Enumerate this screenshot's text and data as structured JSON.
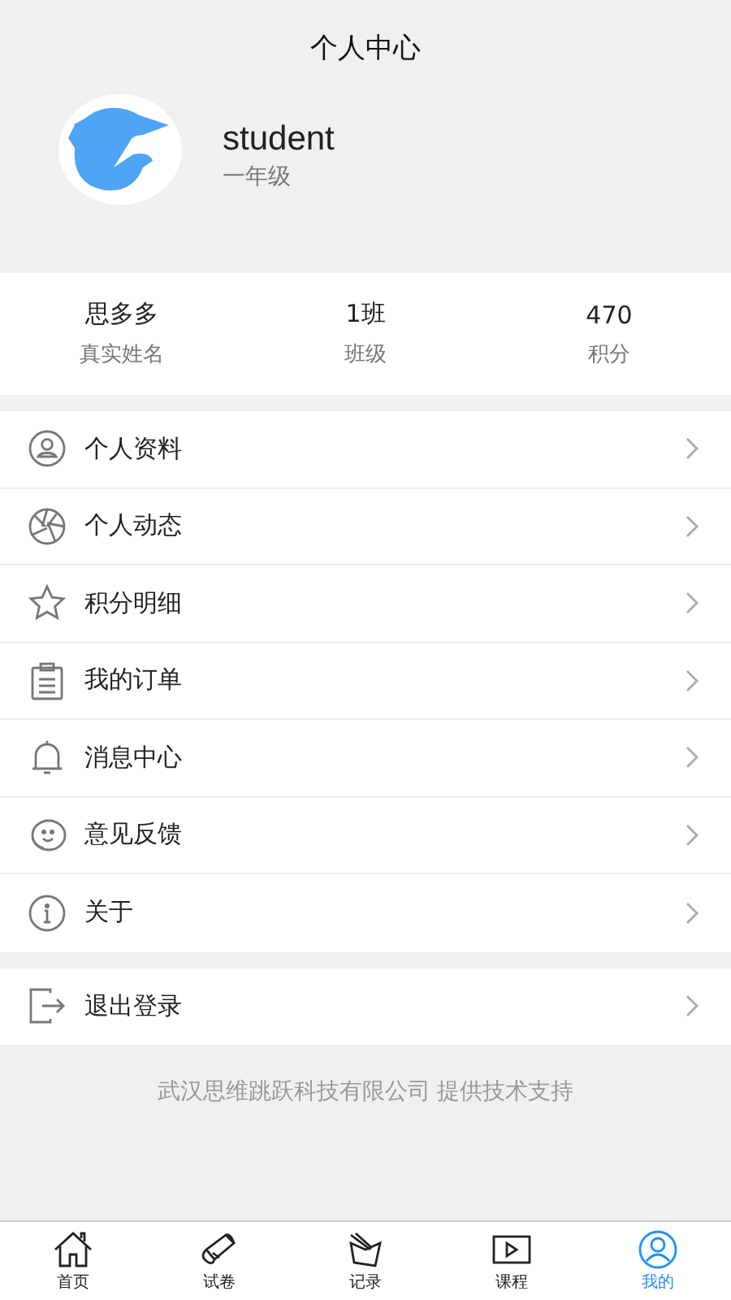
{
  "header": {
    "title": "个人中心"
  },
  "profile": {
    "username": "student",
    "grade": "一年级"
  },
  "stats": [
    {
      "value": "思多多",
      "label": "真实姓名"
    },
    {
      "value": "1班",
      "label": "班级"
    },
    {
      "value": "470",
      "label": "积分"
    }
  ],
  "menu": [
    {
      "kind": "profile",
      "label": "个人资料"
    },
    {
      "kind": "moments",
      "label": "个人动态"
    },
    {
      "kind": "points",
      "label": "积分明细"
    },
    {
      "kind": "orders",
      "label": "我的订单"
    },
    {
      "kind": "messages",
      "label": "消息中心"
    },
    {
      "kind": "feedback",
      "label": "意见反馈"
    },
    {
      "kind": "about",
      "label": "关于"
    }
  ],
  "logout": {
    "kind": "logout",
    "label": "退出登录"
  },
  "footer": "武汉思维跳跃科技有限公司 提供技术支持",
  "tabs": [
    {
      "kind": "home",
      "label": "首页",
      "selected": false
    },
    {
      "kind": "papers",
      "label": "试卷",
      "selected": false
    },
    {
      "kind": "records",
      "label": "记录",
      "selected": false
    },
    {
      "kind": "courses",
      "label": "课程",
      "selected": false
    },
    {
      "kind": "me",
      "label": "我的",
      "selected": true
    }
  ]
}
